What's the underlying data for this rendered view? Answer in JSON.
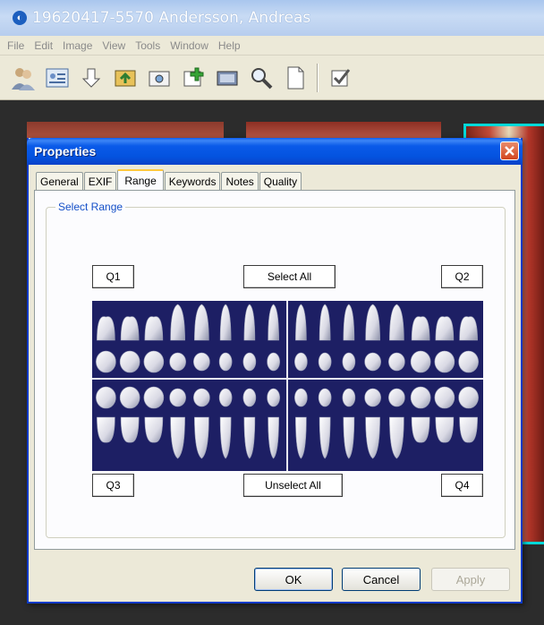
{
  "app": {
    "title": "19620417-5570 Andersson, Andreas",
    "menu": [
      "File",
      "Edit",
      "Image",
      "View",
      "Tools",
      "Window",
      "Help"
    ],
    "toolbar_icons": [
      "patient-group-icon",
      "patient-card-icon",
      "import-arrow-icon",
      "acquire-image-icon",
      "camera-icon",
      "add-image-icon",
      "xray-icon",
      "magnifier-icon",
      "new-document-icon",
      "checklist-icon"
    ]
  },
  "dialog": {
    "title": "Properties",
    "close_icon": "close-icon",
    "tabs": [
      {
        "label": "General",
        "active": false
      },
      {
        "label": "EXIF",
        "active": false
      },
      {
        "label": "Range",
        "active": true
      },
      {
        "label": "Keywords",
        "active": false
      },
      {
        "label": "Notes",
        "active": false
      },
      {
        "label": "Quality",
        "active": false
      }
    ],
    "group_label": "Select Range",
    "q1": "Q1",
    "q2": "Q2",
    "q3": "Q3",
    "q4": "Q4",
    "select_all": "Select All",
    "unselect_all": "Unselect All",
    "ok": "OK",
    "cancel": "Cancel",
    "apply": "Apply",
    "apply_enabled": false
  },
  "colors": {
    "dental_chart_bg": "#1d1f64",
    "selection_frame": "#00d8d8",
    "dialog_title": "#0453df"
  }
}
